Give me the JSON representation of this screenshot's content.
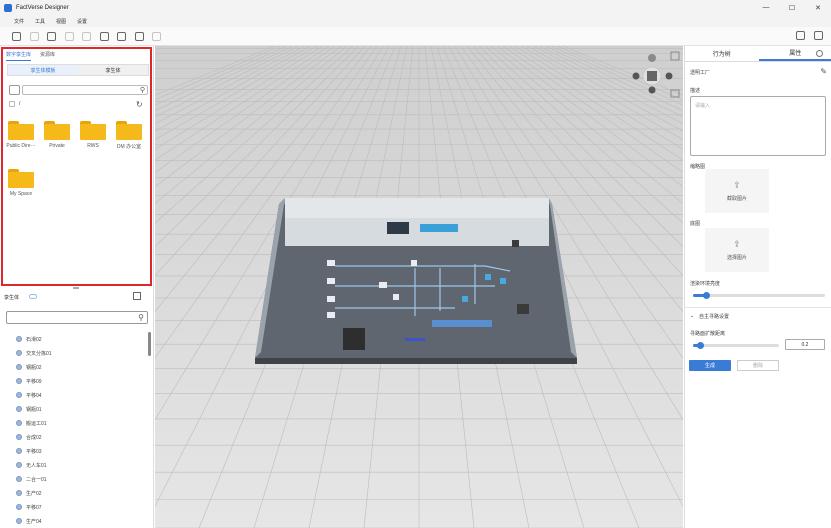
{
  "window": {
    "title": "FactVerse Designer",
    "controls": [
      "—",
      "☐",
      "✕"
    ]
  },
  "menu": [
    "文件",
    "工具",
    "视图",
    "设置"
  ],
  "left": {
    "tabs": [
      "数字孪生库",
      "资源库"
    ],
    "segments": [
      "孪生体模板",
      "孪生体"
    ],
    "path": "/",
    "folders": [
      "Public Dire···",
      "Private",
      "RWS",
      "DM 办公室",
      "My Space"
    ],
    "twin_header": "孪生体",
    "twin_items": [
      "石滑02",
      "交叉分拣01",
      "钢瓶02",
      "平移09",
      "平移04",
      "钢瓶01",
      "搬运工01",
      "合成02",
      "平移03",
      "无人车01",
      "二合一01",
      "生产02",
      "平移07",
      "生产04"
    ]
  },
  "right": {
    "tabs": [
      "行为树",
      "属性"
    ],
    "name": "透明工厂",
    "description_label": "描述",
    "description_placeholder": "请输入",
    "thumbnail_label": "缩略图",
    "thumbnail_action": "截取图片",
    "base_label": "底图",
    "base_action": "选择图片",
    "env_label": "渲染环境亮度",
    "env_brightness": 0.1,
    "path_section": "自主寻路设置",
    "expand_label": "寻路面扩散距离",
    "expand_value": "0.2",
    "expand_slider": 0.08,
    "generate": "生成",
    "delete": "删除"
  },
  "colors": {
    "accent": "#3a7bd5",
    "highlight_border": "#e0262c",
    "folder": "#f5b91a"
  }
}
